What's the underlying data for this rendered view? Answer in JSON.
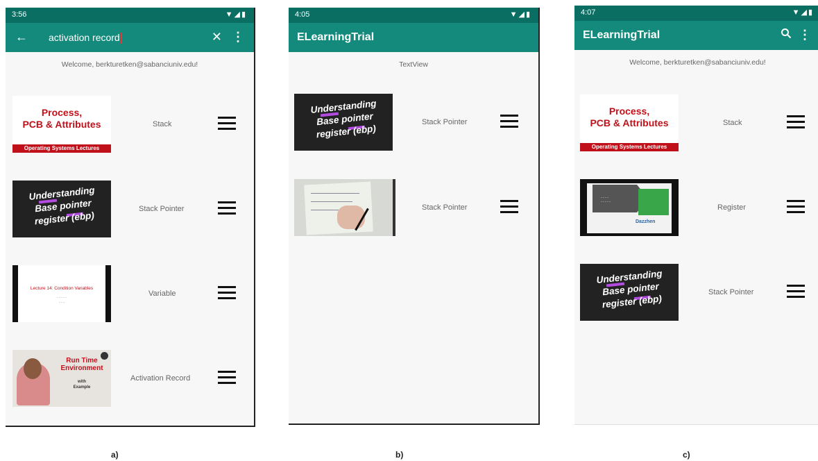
{
  "screens": {
    "a": {
      "time": "3:56",
      "query": "activation record",
      "welcome": "Welcome, berkturetken@sabanciuniv.edu!",
      "items": [
        {
          "label": "Stack",
          "thumb": {
            "line1": "Process,",
            "line2": "PCB & Attributes",
            "banner": "Operating Systems Lectures"
          }
        },
        {
          "label": "Stack Pointer",
          "thumb": {
            "line1": "Understanding",
            "line2": "Base pointer",
            "line3": "register (ebp)"
          }
        },
        {
          "label": "Variable",
          "thumb": {
            "line1": "Lecture 14: Condition Variables"
          }
        },
        {
          "label": "Activation Record",
          "thumb": {
            "line1": "Run Time",
            "line2": "Environment",
            "line3": "with",
            "line4": "Example"
          }
        }
      ],
      "caption": "a)"
    },
    "b": {
      "time": "4:05",
      "app_title": "ELearningTrial",
      "textview": "TextView",
      "items": [
        {
          "label": "Stack Pointer",
          "thumb": {
            "line1": "Understanding",
            "line2": "Base pointer",
            "line3": "register (ebp)"
          }
        },
        {
          "label": "Stack Pointer"
        }
      ],
      "caption": "b)"
    },
    "c": {
      "time": "4:07",
      "app_title": "ELearningTrial",
      "welcome": "Welcome, berkturetken@sabanciuniv.edu!",
      "items": [
        {
          "label": "Stack",
          "thumb": {
            "line1": "Process,",
            "line2": "PCB & Attributes",
            "banner": "Operating Systems Lectures"
          }
        },
        {
          "label": "Register",
          "thumb": {
            "logo": "Dazzhen"
          }
        },
        {
          "label": "Stack Pointer",
          "thumb": {
            "line1": "Understanding",
            "line2": "Base pointer",
            "line3": "register (ebp)"
          }
        }
      ],
      "caption": "c)"
    }
  },
  "icons": {
    "back": "arrow-left-icon",
    "clear": "close-icon",
    "search": "search-icon",
    "more": "more-vert-icon",
    "menu": "hamburger-menu-icon",
    "status": "wifi-signal-battery-icon"
  },
  "colors": {
    "appbar": "#138a7b",
    "statusbar": "#0a6e63",
    "accent_red": "#c0101a"
  }
}
